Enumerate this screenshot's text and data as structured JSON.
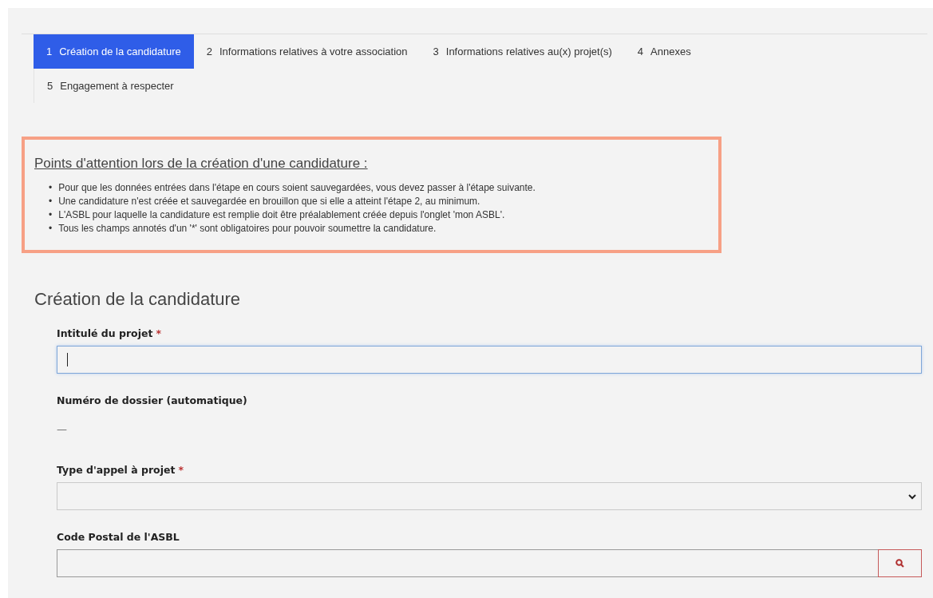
{
  "tabs": [
    {
      "number": "1",
      "label": "Création de la candidature",
      "selected": true
    },
    {
      "number": "2",
      "label": "Informations relatives à votre association",
      "selected": false
    },
    {
      "number": "3",
      "label": "Informations relatives au(x) projet(s)",
      "selected": false
    },
    {
      "number": "4",
      "label": "Annexes",
      "selected": false
    },
    {
      "number": "5",
      "label": "Engagement à respecter",
      "selected": false
    }
  ],
  "notice": {
    "title": "Points d'attention lors de la création d'une candidature :",
    "items": [
      {
        "bullet": "•",
        "text": "Pour que les données entrées dans l'étape en cours soient sauvegardées, vous devez passer à l'étape suivante."
      },
      {
        "bullet": "•",
        "text": "Une candidature n'est créée et sauvegardée en brouillon que si elle a atteint l'étape 2, au minimum."
      },
      {
        "bullet": "•",
        "text": "L'ASBL pour laquelle la candidature est remplie doit être préalablement créée depuis l'onglet 'mon ASBL'."
      },
      {
        "bullet": "•",
        "text": "Tous les champs annotés d'un '*' sont obligatoires pour pouvoir soumettre la candidature."
      }
    ]
  },
  "section": {
    "title": "Création de la candidature"
  },
  "fields": [
    {
      "kind": "text",
      "label": "Intitulé du projet",
      "required_mark": "*",
      "focused": true
    },
    {
      "kind": "readonly",
      "label": "Numéro de dossier (automatique)",
      "value": "—"
    },
    {
      "kind": "select",
      "label": "Type d'appel à projet",
      "required_mark": "*",
      "focused": false
    },
    {
      "kind": "search",
      "label": "Code Postal de l'ASBL",
      "focused": false
    }
  ]
}
